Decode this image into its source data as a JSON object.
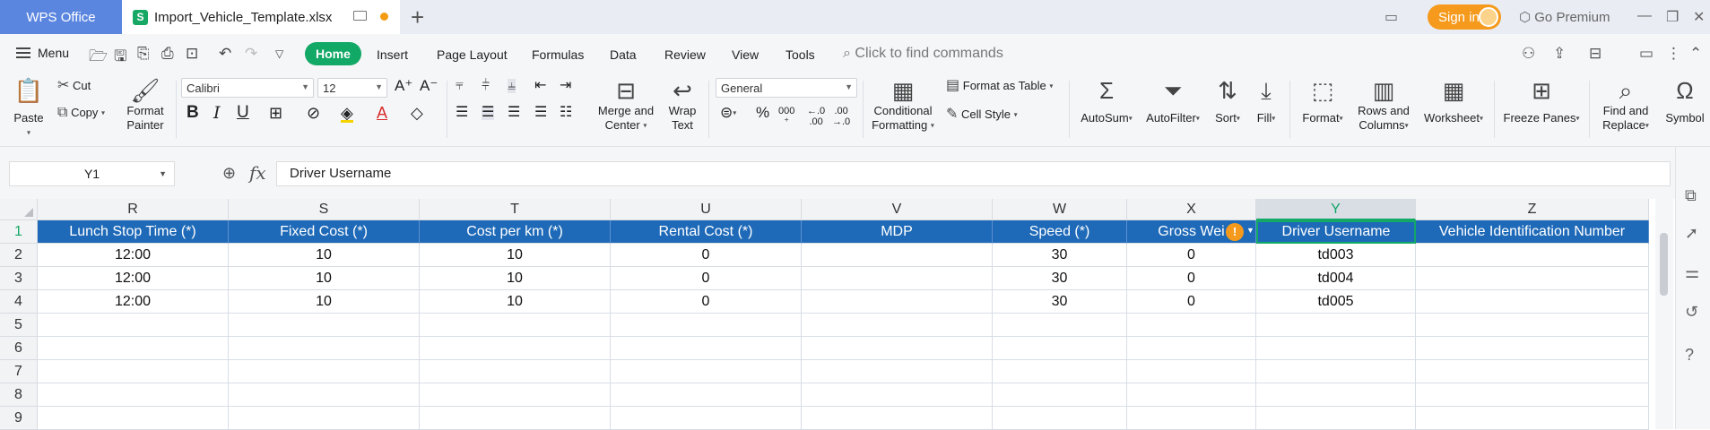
{
  "titlebar": {
    "app_tab": "WPS Office",
    "file_tab": "Import_Vehicle_Template.xlsx",
    "new_tab": "+",
    "sign_in": "Sign in",
    "go_premium": "Go Premium"
  },
  "menubar": {
    "menu": "Menu",
    "tabs": [
      "Home",
      "Insert",
      "Page Layout",
      "Formulas",
      "Data",
      "Review",
      "View",
      "Tools"
    ],
    "find_commands": "Click to find commands"
  },
  "ribbon": {
    "paste": "Paste",
    "cut": "Cut",
    "copy": "Copy",
    "format_painter_1": "Format",
    "format_painter_2": "Painter",
    "font_name": "Calibri",
    "font_size": "12",
    "merge_1": "Merge and",
    "merge_2": "Center",
    "wrap_1": "Wrap",
    "wrap_2": "Text",
    "number_format": "General",
    "conditional_1": "Conditional",
    "conditional_2": "Formatting",
    "format_as_table": "Format as Table",
    "cell_style": "Cell Style",
    "autosum": "AutoSum",
    "autofilter": "AutoFilter",
    "sort": "Sort",
    "fill": "Fill",
    "format": "Format",
    "rows_cols_1": "Rows and",
    "rows_cols_2": "Columns",
    "worksheet": "Worksheet",
    "freeze_panes": "Freeze Panes",
    "find_replace_1": "Find and",
    "find_replace_2": "Replace",
    "symbol": "Symbol"
  },
  "formula_bar": {
    "name_box": "Y1",
    "fx": "fx",
    "content": "Driver Username"
  },
  "grid": {
    "columns": [
      "R",
      "S",
      "T",
      "U",
      "V",
      "W",
      "X",
      "Y",
      "Z"
    ],
    "selected_column": "Y",
    "rows": [
      "1",
      "2",
      "3",
      "4",
      "5",
      "6",
      "7",
      "8",
      "9"
    ],
    "header_row": [
      "Lunch Stop Time (*)",
      "Fixed Cost (*)",
      "Cost per km (*)",
      "Rental Cost (*)",
      "MDP",
      "Speed (*)",
      "Gross Wei",
      "Driver Username",
      "Vehicle Identification Number"
    ],
    "data_rows": [
      [
        "12:00",
        "10",
        "10",
        "0",
        "",
        "30",
        "0",
        "td003",
        ""
      ],
      [
        "12:00",
        "10",
        "10",
        "0",
        "",
        "30",
        "0",
        "td004",
        ""
      ],
      [
        "12:00",
        "10",
        "10",
        "0",
        "",
        "30",
        "0",
        "td005",
        ""
      ]
    ],
    "warning_badge": "!"
  }
}
